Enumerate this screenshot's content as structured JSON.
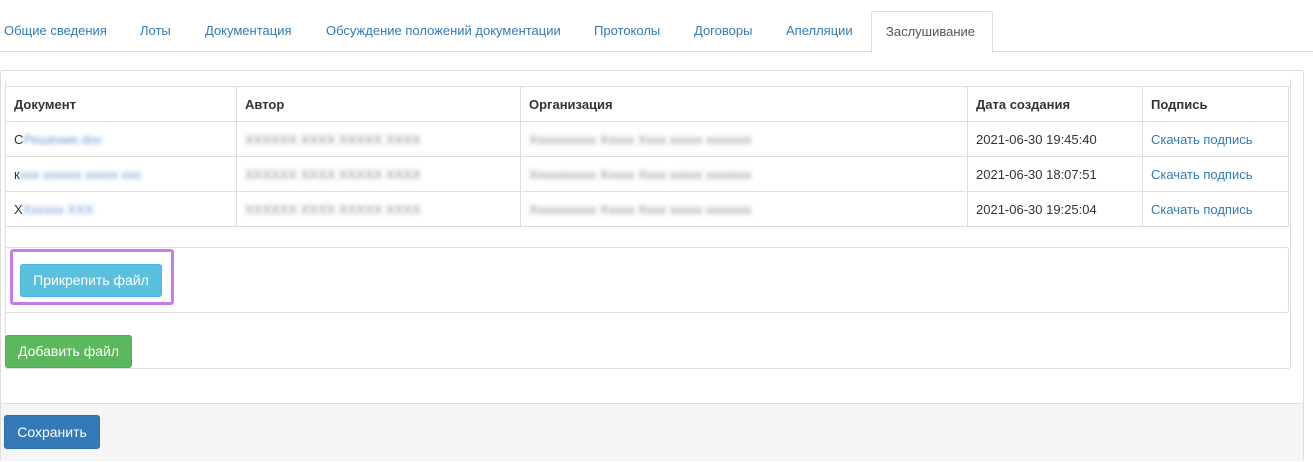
{
  "tabs": [
    {
      "label": "Общие сведения"
    },
    {
      "label": "Лоты"
    },
    {
      "label": "Документация"
    },
    {
      "label": "Обсуждение положений документации"
    },
    {
      "label": "Протоколы"
    },
    {
      "label": "Договоры"
    },
    {
      "label": "Апелляции"
    },
    {
      "label": "Заслушивание",
      "active": true
    }
  ],
  "table": {
    "headers": [
      "Документ",
      "Автор",
      "Организация",
      "Дата создания",
      "Подпись"
    ],
    "rows": [
      {
        "doc_first": "С",
        "doc": "Решение.doc",
        "author": "ХХХХХХ ХХХХ ХХХХХ ХХХХ",
        "org": "Хххххххххх Ххххх Хххх ххххх ххххххх",
        "date": "2021-06-30 19:45:40",
        "sig": "Скачать подпись"
      },
      {
        "doc_first": "к",
        "doc": "ххх хххххх ххххх ххх",
        "author": "ХХХХХХ ХХХХ ХХХХХ ХХХХ",
        "org": "Хххххххххх Ххххх Хххх ххххх ххххххх",
        "date": "2021-06-30 18:07:51",
        "sig": "Скачать подпись"
      },
      {
        "doc_first": "Х",
        "doc": "Хххххх ХХХ",
        "author": "ХХХХХХ ХХХХ ХХХХХ ХХХХ",
        "org": "Хххххххххх Ххххх Хххх ххххх ххххххх",
        "date": "2021-06-30 19:25:04",
        "sig": "Скачать подпись"
      }
    ]
  },
  "buttons": {
    "attach": "Прикрепить файл",
    "add": "Добавить файл",
    "save": "Сохранить"
  },
  "colors": {
    "accent": "#337ab7",
    "attach_btn": "#5bc0de",
    "add_btn": "#5cb85c",
    "highlight": "#c77bf0"
  }
}
